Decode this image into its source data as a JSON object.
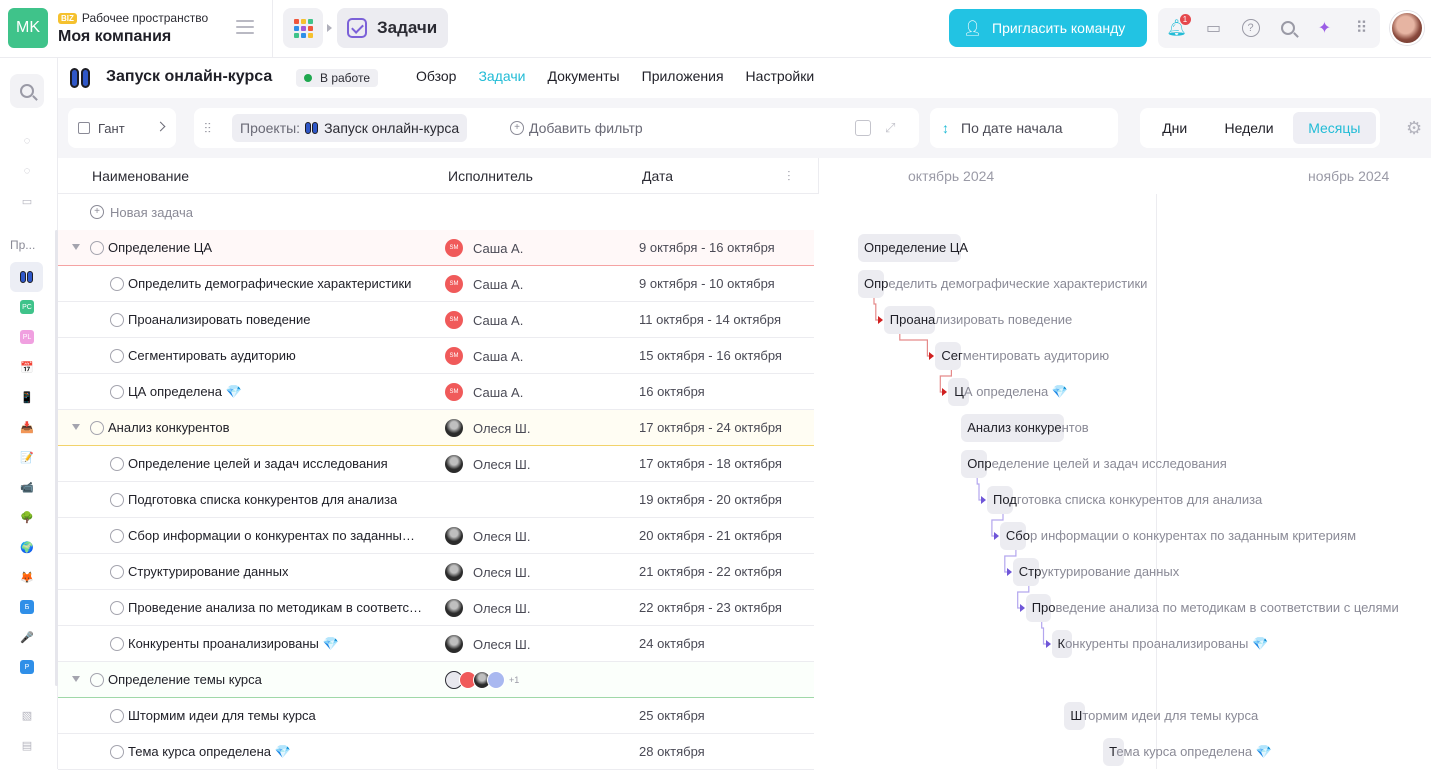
{
  "topbar": {
    "logo_initials": "MK",
    "workspace_badge": "BIZ",
    "workspace_label": "Рабочее пространство",
    "company_name": "Моя компания",
    "section_title": "Задачи",
    "invite_label": "Пригласить команду",
    "notification_count": "1"
  },
  "project": {
    "title": "Запуск онлайн-курса",
    "status": "В работе",
    "tabs": [
      {
        "label": "Обзор"
      },
      {
        "label": "Задачи"
      },
      {
        "label": "Документы"
      },
      {
        "label": "Приложения"
      },
      {
        "label": "Настройки"
      }
    ],
    "active_tab": "Задачи"
  },
  "sidebar": {
    "section_label": "Пр...",
    "projects": [
      {
        "badge": "PC",
        "color": "#3fc38a"
      },
      {
        "badge": "PL",
        "color": "#f0a0e0"
      },
      {
        "badge": "Б",
        "color": "#2f8fe8"
      },
      {
        "badge": "P",
        "color": "#2f8fe8"
      }
    ]
  },
  "toolbar": {
    "view_label": "Гант",
    "filter_prefix": "Проекты:",
    "filter_project": "Запуск онлайн-курса",
    "add_filter": "Добавить фильтр",
    "sort_label": "По дате начала",
    "scales": [
      "Дни",
      "Недели",
      "Месяцы"
    ],
    "active_scale": "Месяцы"
  },
  "table": {
    "headers": {
      "name": "Наименование",
      "assignee": "Исполнитель",
      "date": "Дата"
    },
    "new_task": "Новая задача",
    "rows": [
      {
        "name": "Определение ЦА",
        "assignee": "Саша А.",
        "av": "sasha",
        "date": "9 октября - 16 октября",
        "group": true,
        "color": "#f5a3a3",
        "bg": "#fff8f8"
      },
      {
        "name": "Определить демографические характеристики",
        "assignee": "Саша А.",
        "av": "sasha",
        "date": "9 октября - 10 октября"
      },
      {
        "name": "Проанализировать поведение",
        "assignee": "Саша А.",
        "av": "sasha",
        "date": "11 октября - 14 октября"
      },
      {
        "name": "Сегментировать аудиторию",
        "assignee": "Саша А.",
        "av": "sasha",
        "date": "15 октября - 16 октября"
      },
      {
        "name": "ЦА определена 💎",
        "assignee": "Саша А.",
        "av": "sasha",
        "date": "16 октября"
      },
      {
        "name": "Анализ конкурентов",
        "assignee": "Олеся Ш.",
        "av": "olesya",
        "date": "17 октября - 24 октября",
        "group": true,
        "color": "#f2d36b",
        "bg": "#fffdf3"
      },
      {
        "name": "Определение целей и задач исследования",
        "assignee": "Олеся Ш.",
        "av": "olesya",
        "date": "17 октября - 18 октября"
      },
      {
        "name": "Подготовка списка конкурентов для анализа",
        "assignee": "",
        "av": "",
        "date": "19 октября - 20 октября"
      },
      {
        "name": "Сбор информации о конкурентах по заданным критериям",
        "assignee": "Олеся Ш.",
        "av": "olesya",
        "date": "20 октября - 21 октября"
      },
      {
        "name": "Структурирование данных",
        "assignee": "Олеся Ш.",
        "av": "olesya",
        "date": "21 октября - 22 октября"
      },
      {
        "name": "Проведение анализа по методикам в соответствии с целями",
        "assignee": "Олеся Ш.",
        "av": "olesya",
        "date": "22 октября - 23 октября"
      },
      {
        "name": "Конкуренты проанализированы 💎",
        "assignee": "Олеся Ш.",
        "av": "olesya",
        "date": "24 октября"
      },
      {
        "name": "Определение темы курса",
        "assignee": "",
        "av": "stack",
        "date": "",
        "group": true,
        "color": "#9fd8a8",
        "bg": "#fbfffb",
        "more": "+1"
      },
      {
        "name": "Штормим идеи для темы курса",
        "assignee": "",
        "av": "",
        "date": "25 октября"
      },
      {
        "name": "Тема курса определена 💎",
        "assignee": "",
        "av": "",
        "date": "28 октября"
      }
    ]
  },
  "gantt": {
    "months": [
      "октябрь 2024",
      "ноябрь 2024"
    ],
    "bars": [
      {
        "label": "Определение ЦА",
        "split": 14
      },
      {
        "label": "Определить демографические характеристики",
        "split": 3
      },
      {
        "label": "Проанализировать поведение",
        "split": 6
      },
      {
        "label": "Сегментировать аудиторию",
        "split": 3
      },
      {
        "label": "ЦА определена 💎",
        "split": 1
      },
      {
        "label": "Анализ конкурентов",
        "split": 14
      },
      {
        "label": "Определение целей и задач исследования",
        "split": 3
      },
      {
        "label": "Подготовка списка конкурентов для анализа",
        "split": 3
      },
      {
        "label": "Сбор информации о конкурентах по заданным критериям",
        "split": 3
      },
      {
        "label": "Структурирование данных",
        "split": 3
      },
      {
        "label": "Проведение анализа по методикам в соответствии с целями",
        "split": 3
      },
      {
        "label": "Конкуренты проанализированы 💎",
        "split": 1
      },
      {
        "label": "",
        "split": 0
      },
      {
        "label": "Штормим идеи для темы курса",
        "split": 1
      },
      {
        "label": "Тема курса определена 💎",
        "split": 1
      }
    ]
  }
}
